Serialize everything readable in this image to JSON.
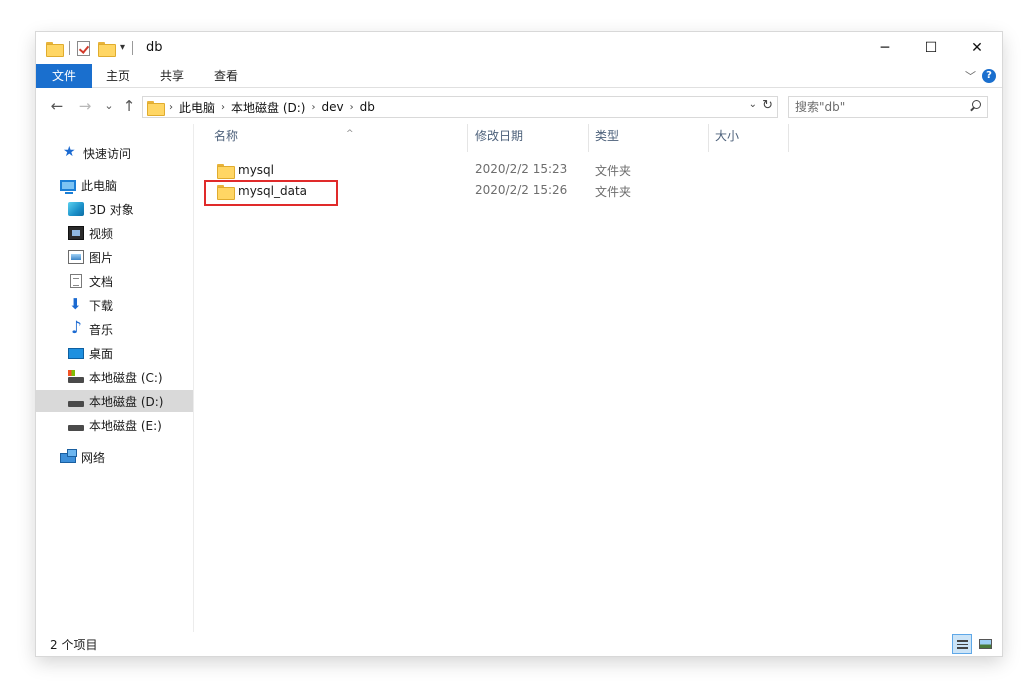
{
  "window": {
    "title": "db",
    "minimize": "─",
    "maximize": "☐",
    "close": "✕"
  },
  "ribbon": {
    "tabs": [
      "文件",
      "主页",
      "共享",
      "查看"
    ],
    "help": "?",
    "expand": "﹀"
  },
  "nav": {
    "back": "←",
    "forward": "→",
    "recent": "⌄",
    "up": "↑",
    "breadcrumb": [
      "此电脑",
      "本地磁盘 (D:)",
      "dev",
      "db"
    ],
    "crumb_sep": "›",
    "dropdown": "⌄",
    "refresh": "↻"
  },
  "search": {
    "placeholder": "搜索\"db\""
  },
  "sidebar": {
    "items": [
      {
        "label": "快速访问",
        "icon": "star-icon"
      },
      {
        "label": "此电脑",
        "icon": "computer-icon"
      },
      {
        "label": "3D 对象",
        "icon": "3d-objects-icon"
      },
      {
        "label": "视频",
        "icon": "video-icon"
      },
      {
        "label": "图片",
        "icon": "pictures-icon"
      },
      {
        "label": "文档",
        "icon": "documents-icon"
      },
      {
        "label": "下载",
        "icon": "download-icon"
      },
      {
        "label": "音乐",
        "icon": "music-icon"
      },
      {
        "label": "桌面",
        "icon": "desktop-icon"
      },
      {
        "label": "本地磁盘 (C:)",
        "icon": "drive-icon"
      },
      {
        "label": "本地磁盘 (D:)",
        "icon": "drive-icon",
        "selected": true
      },
      {
        "label": "本地磁盘 (E:)",
        "icon": "drive-icon"
      },
      {
        "label": "网络",
        "icon": "network-icon"
      }
    ]
  },
  "filelist": {
    "columns": [
      "名称",
      "修改日期",
      "类型",
      "大小"
    ],
    "sort_indicator": "^",
    "rows": [
      {
        "name": "mysql",
        "modified": "2020/2/2 15:23",
        "type": "文件夹",
        "size": ""
      },
      {
        "name": "mysql_data",
        "modified": "2020/2/2 15:26",
        "type": "文件夹",
        "size": ""
      }
    ]
  },
  "status": {
    "item_count": "2 个项目"
  },
  "colors": {
    "accent": "#1a6fce",
    "highlight_box": "#e02a2a",
    "folder": "#ffd664",
    "selected_nav": "#d9d9d9"
  }
}
